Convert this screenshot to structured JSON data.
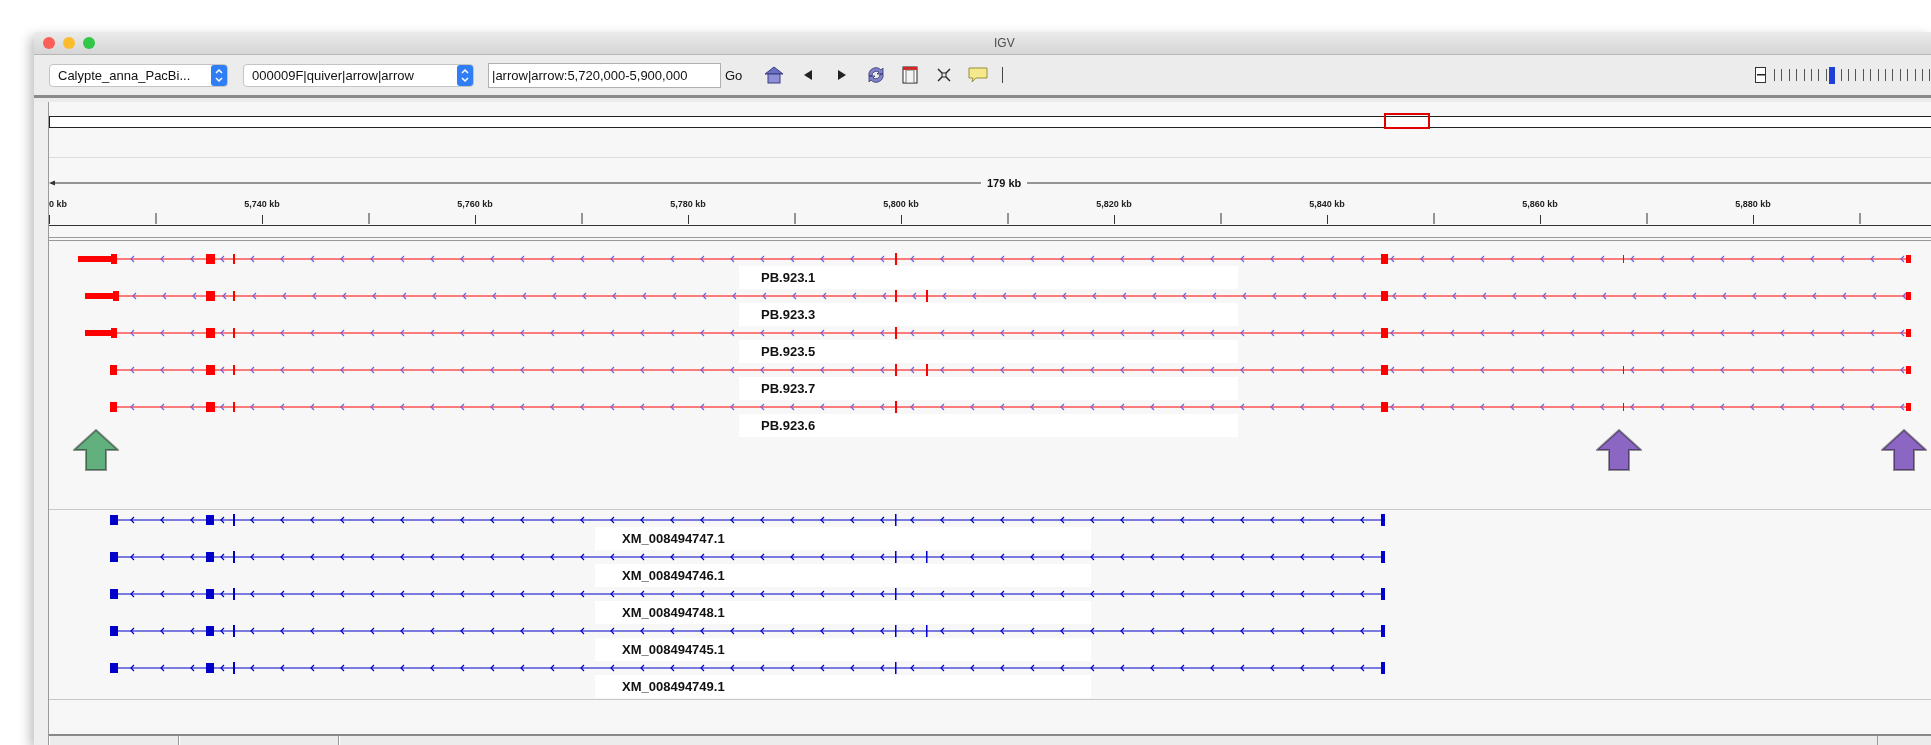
{
  "window": {
    "title": "IGV"
  },
  "toolbar": {
    "genome": "Calypte_anna_PacBi...",
    "chromosome": "000009F|quiver|arrow|arrow",
    "locus": "|arrow|arrow:5,720,000-5,900,000",
    "go": "Go",
    "zoom": {
      "level": 0.37
    }
  },
  "ruler": {
    "span": "179 kb",
    "tick_labels": [
      "0 kb",
      "5,740 kb",
      "5,760 kb",
      "5,780 kb",
      "5,800 kb",
      "5,820 kb",
      "5,840 kb",
      "5,860 kb",
      "5,880 kb"
    ]
  },
  "tracks": [
    {
      "kind": "isoseq",
      "color": "#ff0000",
      "features": [
        {
          "label": "PB.923.1"
        },
        {
          "label": "PB.923.3"
        },
        {
          "label": "PB.923.5"
        },
        {
          "label": "PB.923.7"
        },
        {
          "label": "PB.923.6"
        }
      ]
    },
    {
      "kind": "refseq",
      "color": "#0000c8",
      "features": [
        {
          "label": "XM_008494747.1"
        },
        {
          "label": "XM_008494746.1"
        },
        {
          "label": "XM_008494748.1"
        },
        {
          "label": "XM_008494745.1"
        },
        {
          "label": "XM_008494749.1"
        }
      ]
    }
  ],
  "markers": [
    {
      "color": "#63b07f"
    },
    {
      "color": "#8b66c2"
    },
    {
      "color": "#8b66c2"
    }
  ]
}
